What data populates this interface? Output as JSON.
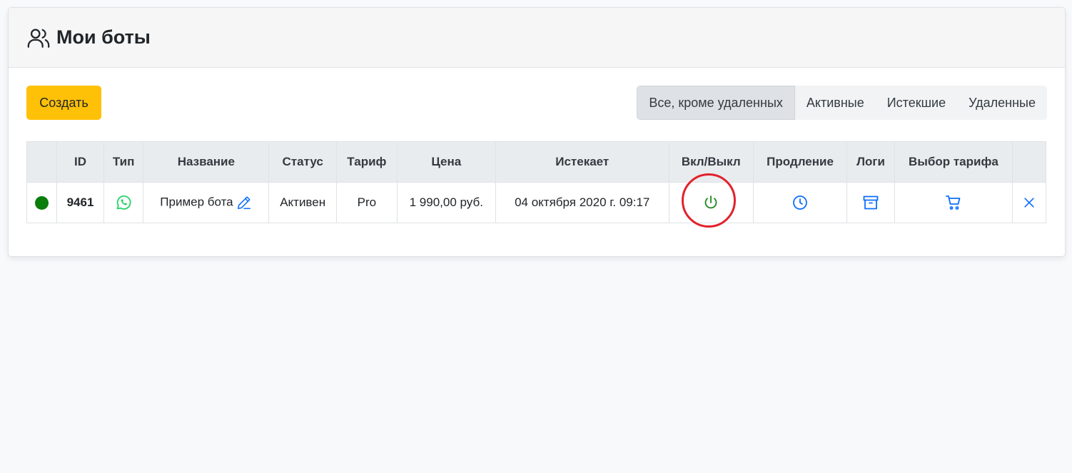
{
  "header": {
    "title": "Мои боты"
  },
  "toolbar": {
    "create_label": "Создать"
  },
  "filters": [
    {
      "label": "Все, кроме удаленных",
      "active": true
    },
    {
      "label": "Активные",
      "active": false
    },
    {
      "label": "Истекшие",
      "active": false
    },
    {
      "label": "Удаленные",
      "active": false
    }
  ],
  "table": {
    "columns": [
      "",
      "ID",
      "Тип",
      "Название",
      "Статус",
      "Тариф",
      "Цена",
      "Истекает",
      "Вкл/Выкл",
      "Продление",
      "Логи",
      "Выбор тарифа",
      ""
    ],
    "rows": [
      {
        "status_color": "#0a7d0a",
        "id": "9461",
        "type_icon": "whatsapp-icon",
        "name": "Пример бота",
        "status": "Активен",
        "tariff": "Pro",
        "price": "1 990,00 руб.",
        "expires": "04 октября 2020 г. 09:17"
      }
    ]
  },
  "colors": {
    "accent": "#ffc107",
    "link": "#0d6efd",
    "power": "#1a8a1a",
    "whatsapp": "#25d366",
    "highlight_ring": "#e1222c"
  }
}
